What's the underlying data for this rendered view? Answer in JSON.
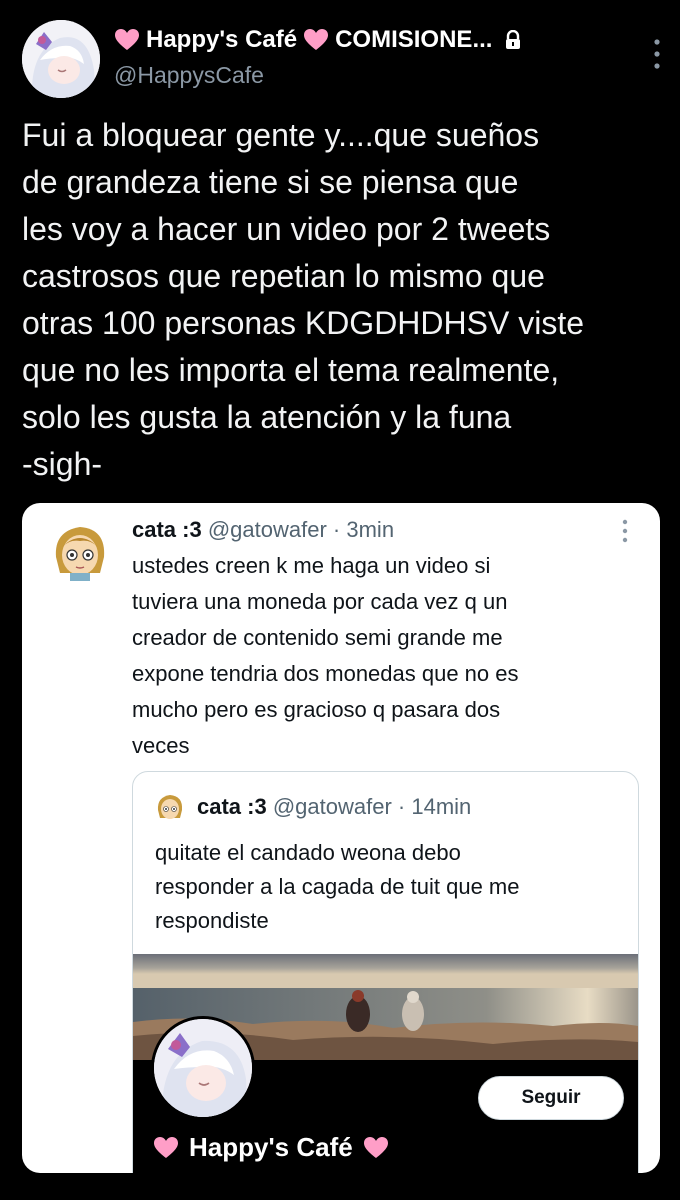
{
  "author": {
    "display_name": "Happy's Café",
    "display_suffix": "COMISIONE...",
    "handle": "@HappysCafe"
  },
  "tweet": {
    "text": "Fui a bloquear gente y....que sueños\nde grandeza tiene si se piensa que\nles voy a hacer un video por 2 tweets\ncastrosos que repetian lo mismo que\notras 100 personas KDGDHDHSV viste\nque no les importa el tema realmente,\nsolo les gusta la atención y la funa\n-sigh-"
  },
  "quote": {
    "name": "cata :3",
    "handle": "@gatowafer",
    "dot": "·",
    "time": "3min",
    "text": "ustedes creen k me haga un video si\ntuviera una moneda por cada vez q un\ncreador de contenido semi grande me\nexpone tendria dos monedas que no es\nmucho pero es gracioso q pasara dos\nveces",
    "inner": {
      "name": "cata :3",
      "handle": "@gatowafer",
      "dot": "·",
      "time": "14min",
      "text": "quitate el candado weona debo\nresponder a la cagada de tuit que me\nrespondiste",
      "embed": {
        "follow_label": "Seguir",
        "profile_name": "Happy's Café"
      }
    }
  },
  "colors": {
    "background": "#000000",
    "heart": "#ff9ec7",
    "secondary_text": "#8b98a5"
  },
  "icons": [
    "heart-icon",
    "lock-icon",
    "more-icon"
  ]
}
